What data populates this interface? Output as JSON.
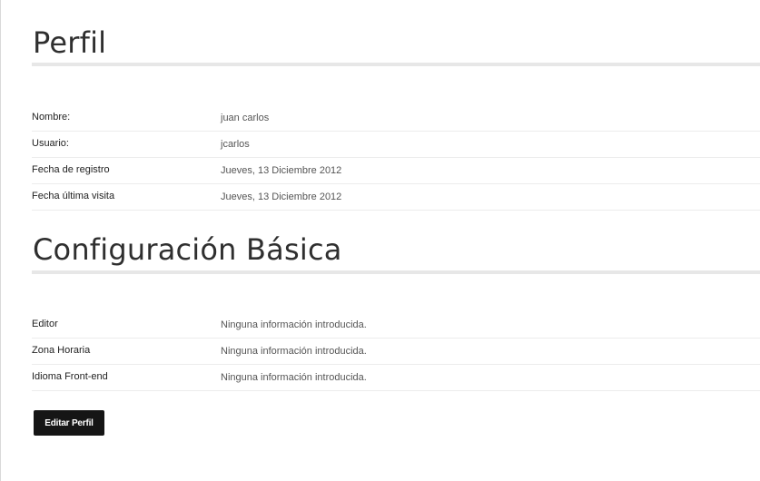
{
  "profile": {
    "title": "Perfil",
    "rows": [
      {
        "label": "Nombre:",
        "value": "juan carlos"
      },
      {
        "label": "Usuario:",
        "value": "jcarlos"
      },
      {
        "label": "Fecha de registro",
        "value": "Jueves, 13 Diciembre 2012"
      },
      {
        "label": "Fecha última visita",
        "value": "Jueves, 13 Diciembre 2012"
      }
    ]
  },
  "basic_config": {
    "title": "Configuración Básica",
    "rows": [
      {
        "label": "Editor",
        "value": "Ninguna información introducida."
      },
      {
        "label": "Zona Horaria",
        "value": "Ninguna información introducida."
      },
      {
        "label": "Idioma Front-end",
        "value": "Ninguna información introducida."
      }
    ]
  },
  "actions": {
    "edit_profile_label": "Editar Perfil"
  }
}
